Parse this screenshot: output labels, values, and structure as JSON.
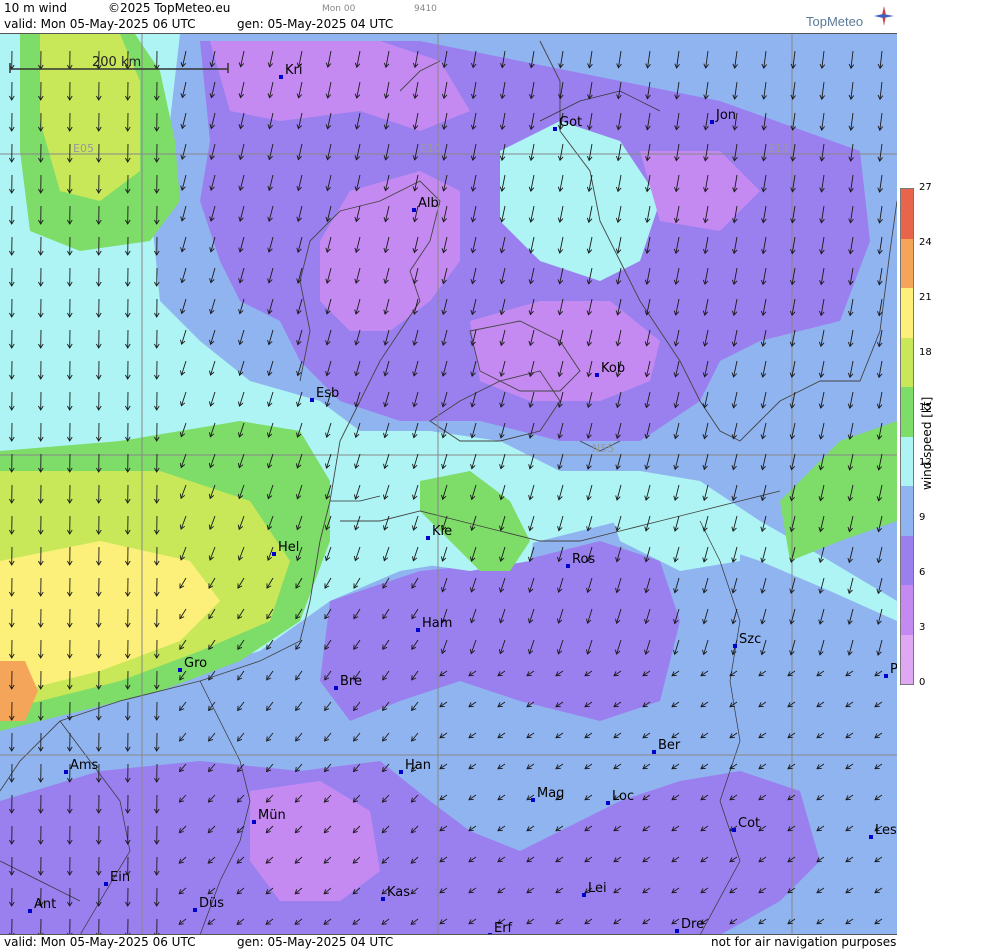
{
  "header": {
    "title": "10 m wind",
    "copyright": "©2025 TopMeteo.eu",
    "run": "Mon 00",
    "code": "9410",
    "valid": "valid:  Mon  05-May-2025  06 UTC",
    "gen": "gen: 05-May-2025 04 UTC"
  },
  "logo": "TopMeteo",
  "scale_bar": "200 km",
  "grid_labels": [
    "E05",
    "E10",
    "E15",
    "N55"
  ],
  "cities": [
    {
      "name": "Kri"
    },
    {
      "name": "Got"
    },
    {
      "name": "Jon"
    },
    {
      "name": "Alb"
    },
    {
      "name": "Kob"
    },
    {
      "name": "Esb"
    },
    {
      "name": "Kie"
    },
    {
      "name": "Hel"
    },
    {
      "name": "Ros"
    },
    {
      "name": "Ham"
    },
    {
      "name": "Szc"
    },
    {
      "name": "Gro"
    },
    {
      "name": "Bre"
    },
    {
      "name": "P"
    },
    {
      "name": "Ber"
    },
    {
      "name": "Ams"
    },
    {
      "name": "Han"
    },
    {
      "name": "Mag"
    },
    {
      "name": "Loc"
    },
    {
      "name": "Mün"
    },
    {
      "name": "Cot"
    },
    {
      "name": "Les"
    },
    {
      "name": "Ein"
    },
    {
      "name": "Lei"
    },
    {
      "name": "Ant"
    },
    {
      "name": "Düs"
    },
    {
      "name": "Kas"
    },
    {
      "name": "Dre"
    },
    {
      "name": "Erf"
    }
  ],
  "legend": {
    "title": "wind speed [kt]",
    "ticks": [
      "27",
      "24",
      "21",
      "18",
      "15",
      "12",
      "9",
      "6",
      "3",
      "0"
    ],
    "colors": [
      "#e8644a",
      "#f4a55a",
      "#fdf07a",
      "#c8e85a",
      "#7edc68",
      "#aef4f4",
      "#90b4f0",
      "#9a80ee",
      "#c58af2",
      "#e0a8f4"
    ]
  },
  "footer": {
    "valid": "valid:  Mon  05-May-2025  06 UTC",
    "gen": "gen: 05-May-2025 04 UTC",
    "note": "not for air navigation purposes"
  }
}
